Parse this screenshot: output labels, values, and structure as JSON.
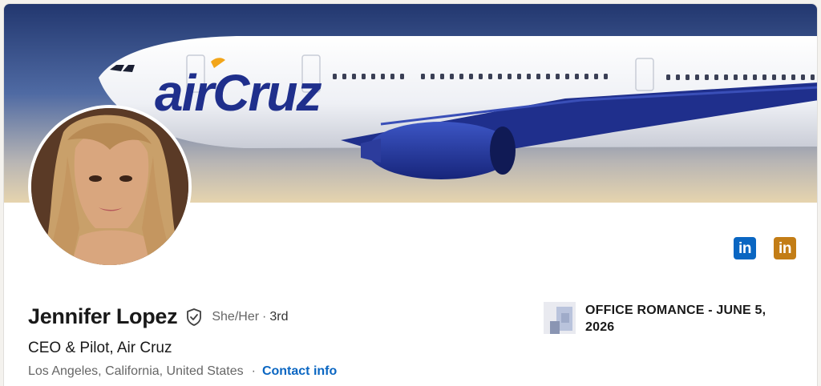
{
  "banner": {
    "airline_logo_text": "airCruz",
    "sky_color_top": "#25407a",
    "sky_color_bottom": "#e8d9b8",
    "fuselage_color": "#f4f5f8",
    "brand_color": "#1f2f8c",
    "accent_color": "#f2a51a"
  },
  "profile": {
    "name": "Jennifer Lopez",
    "pronouns": "She/Her",
    "degree_separator": "·",
    "degree": "3rd",
    "headline": "CEO & Pilot, Air Cruz",
    "location": "Los Angeles, California, United States",
    "location_separator": "·",
    "contact_link": "Contact info"
  },
  "badges": [
    {
      "icon": "linkedin-icon",
      "text": "in",
      "color": "#0a66c2"
    },
    {
      "icon": "linkedin-premium-icon",
      "text": "in",
      "color": "#c37d16"
    }
  ],
  "company": {
    "name": "OFFICE ROMANCE - JUNE 5, 2026"
  },
  "colors": {
    "link": "#0a66c2",
    "text_primary": "#191919",
    "text_secondary": "#666666"
  }
}
